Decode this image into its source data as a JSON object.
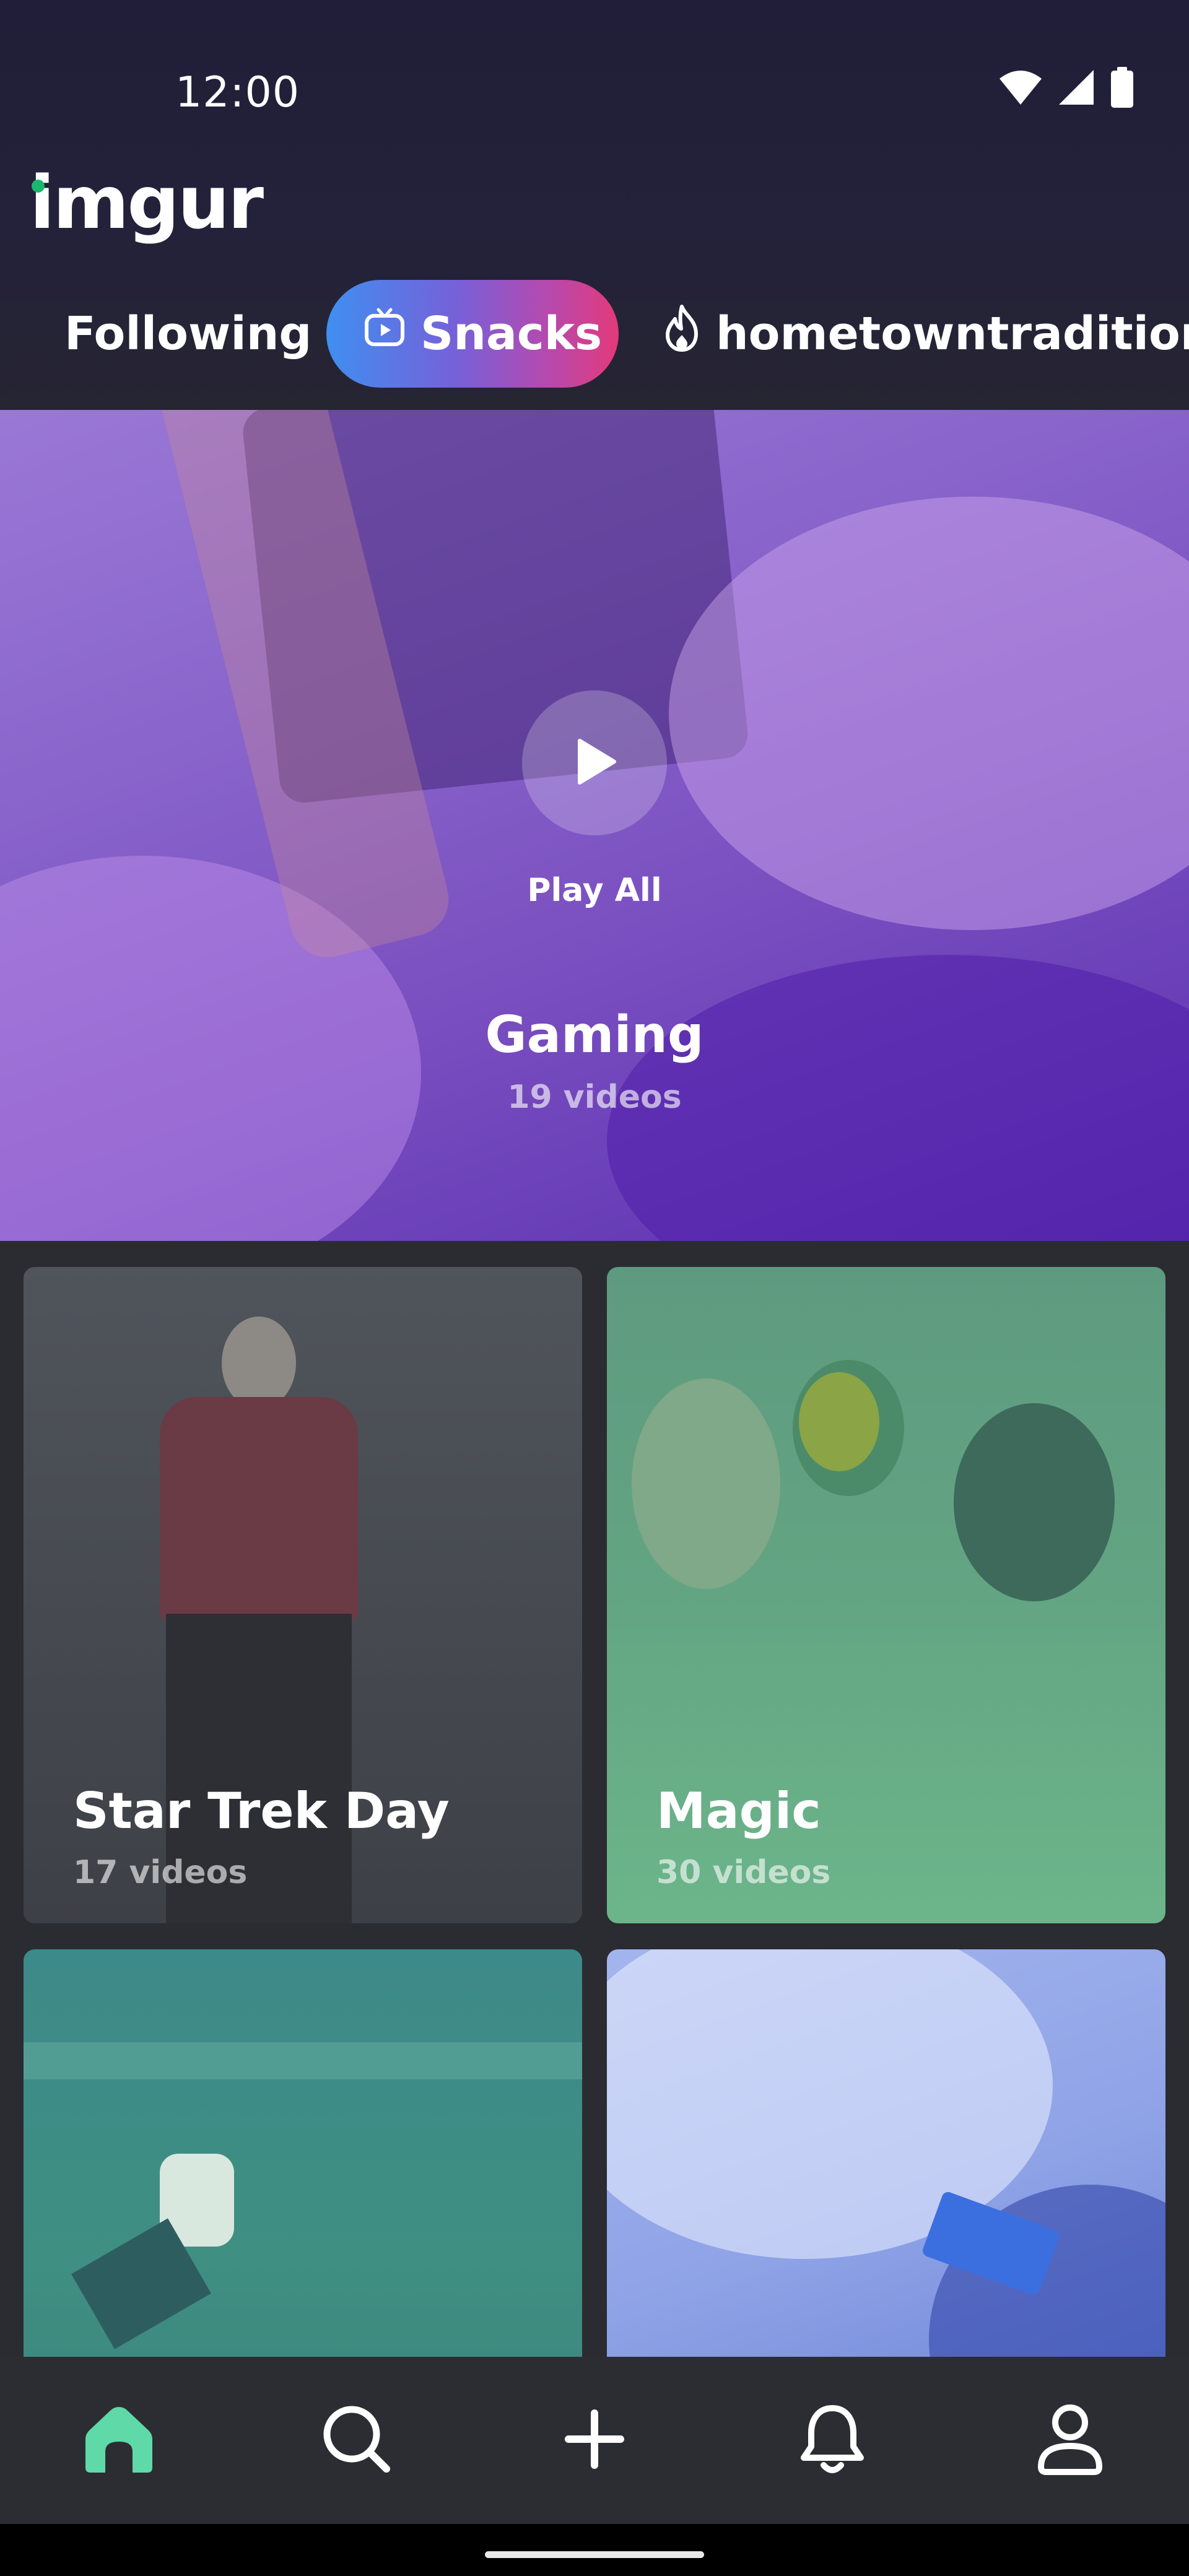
{
  "status_bar": {
    "time": "12:00",
    "icons": [
      "wifi-icon",
      "signal-icon",
      "battery-icon"
    ]
  },
  "header": {
    "logo": "imgur",
    "tabs": [
      {
        "label": "Following",
        "active": false
      },
      {
        "label": "Snacks",
        "active": true,
        "icon": "tv-icon"
      },
      {
        "label": "hometowntradition",
        "active": false,
        "icon": "flame-icon"
      }
    ]
  },
  "hero": {
    "play_label": "Play All",
    "title": "Gaming",
    "subtitle": "19 videos"
  },
  "cards": [
    {
      "title": "Star Trek Day",
      "subtitle": "17 videos"
    },
    {
      "title": "Magic",
      "subtitle": "30 videos"
    },
    {
      "title": "",
      "subtitle": ""
    },
    {
      "title": "",
      "subtitle": ""
    }
  ],
  "bottom_nav": [
    {
      "name": "home",
      "icon": "home-icon",
      "active": true
    },
    {
      "name": "search",
      "icon": "search-icon",
      "active": false
    },
    {
      "name": "create",
      "icon": "plus-icon",
      "active": false
    },
    {
      "name": "notifications",
      "icon": "bell-icon",
      "active": false
    },
    {
      "name": "profile",
      "icon": "user-icon",
      "active": false
    }
  ],
  "colors": {
    "header_bg": "#211f37",
    "snacks_gradient_start": "#3f8ff0",
    "snacks_gradient_end": "#e33a7a",
    "logo_dot": "#1bb76e",
    "home_active": "#5fd9a8",
    "nav_bg": "#2c2d32"
  }
}
